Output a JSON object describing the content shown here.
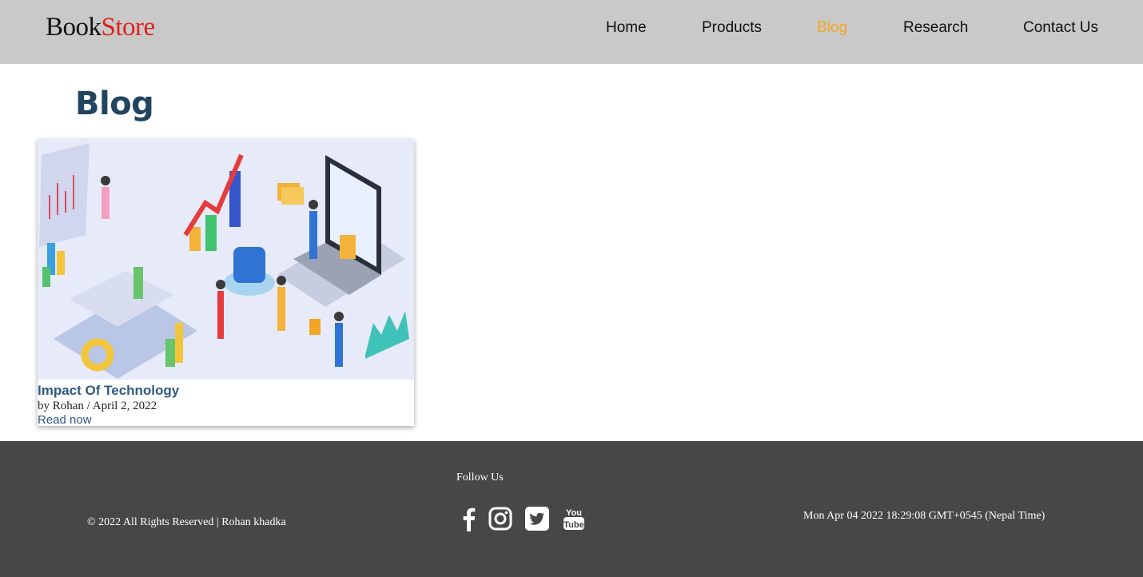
{
  "header": {
    "logo": {
      "part1": "Book",
      "part2": "Store"
    },
    "nav": [
      {
        "label": "Home",
        "active": false
      },
      {
        "label": "Products",
        "active": false
      },
      {
        "label": "Blog",
        "active": true
      },
      {
        "label": "Research",
        "active": false
      },
      {
        "label": "Contact Us",
        "active": false
      }
    ]
  },
  "main": {
    "page_title": "Blog",
    "posts": [
      {
        "image_icon": "technology-illustration",
        "title": "Impact Of Technology",
        "meta": "by Rohan / April 2, 2022",
        "link_label": "Read now"
      }
    ]
  },
  "footer": {
    "copyright": "© 2022 All Rights Reserved | Rohan khadka",
    "follow_label": "Follow Us",
    "socials": [
      {
        "icon": "facebook-icon"
      },
      {
        "icon": "instagram-icon"
      },
      {
        "icon": "twitter-icon"
      },
      {
        "icon": "youtube-icon",
        "text": "You Tube"
      }
    ],
    "datetime": "Mon Apr 04 2022 18:29:08 GMT+0545 (Nepal Time)"
  },
  "colors": {
    "header_bg": "#c9c9c9",
    "nav_active": "#f3a623",
    "logo_accent": "#e0211d",
    "title": "#21455e",
    "link": "#2f5a82",
    "footer_bg": "#474747"
  }
}
